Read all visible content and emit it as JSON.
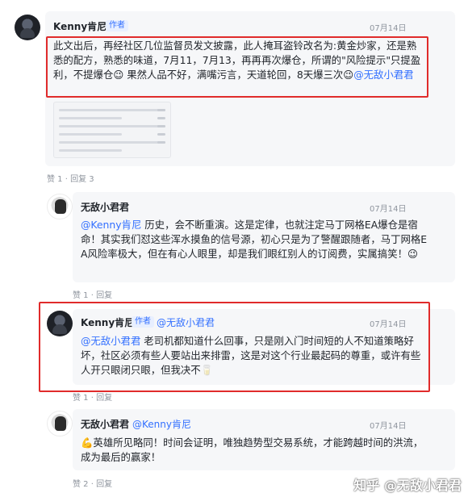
{
  "comments": [
    {
      "author": "Kenny肯尼",
      "tag": "作者",
      "date": "07月14日",
      "text": "此文出后，再经社区几位监督员发文披露，此人掩耳盗铃改名为:黄金炒家，还是熟悉的配方，熟悉的味道，7月11，7月13，再再再次爆仓，所谓的\"风险提示\"只提盈利，不提爆仓😉 果然人品不好，满嘴污言，天道轮回，8天爆三次😉",
      "mention": "@无敌小君君",
      "likes": "赞 1",
      "reply": "回复 3"
    },
    {
      "author": "无敌小君君",
      "date": "07月14日",
      "mention": "@Kenny肯尼",
      "text": " 历史，会不断重演。这是定律，也就注定马丁网格EA爆仓是宿命！其实我们怼这些浑水摸鱼的信号源，初心只是为了警醒跟随者，马丁网格EA风险率极大，但在有心人眼里，却是我们眼红别人的订阅费，实属搞笑！😉",
      "likes": "赞 1",
      "reply": "回复"
    },
    {
      "author": "Kenny肯尼",
      "tag": "作者",
      "reply_to": "@无敌小君君",
      "date": "07月14日",
      "mention": "@无敌小君君",
      "text": " 老司机都知道什么回事，只是刚入门时间短的人不知道策略好坏，社区必须有些人要站出来排雷，这是对这个行业最起码的尊重，或许有些人开只眼闭只眼，但我决不🥛",
      "likes": "赞 1",
      "reply": "回复"
    },
    {
      "author": "无敌小君君",
      "reply_to": "@Kenny肯尼",
      "date": "07月14日",
      "text": "💪英雄所见略同！时间会证明，唯独趋势型交易系统，才能跨越时间的洪流，成为最后的赢家！",
      "likes": "赞 2",
      "reply": "回复"
    }
  ],
  "watermark": "知乎 @无敌小君君",
  "colors": {
    "highlight_border": "#e02b2b",
    "link": "#3370ff",
    "bubble": "#f6f7f9"
  },
  "icons": [
    "user-avatar-icon",
    "logo-avatar-icon"
  ]
}
